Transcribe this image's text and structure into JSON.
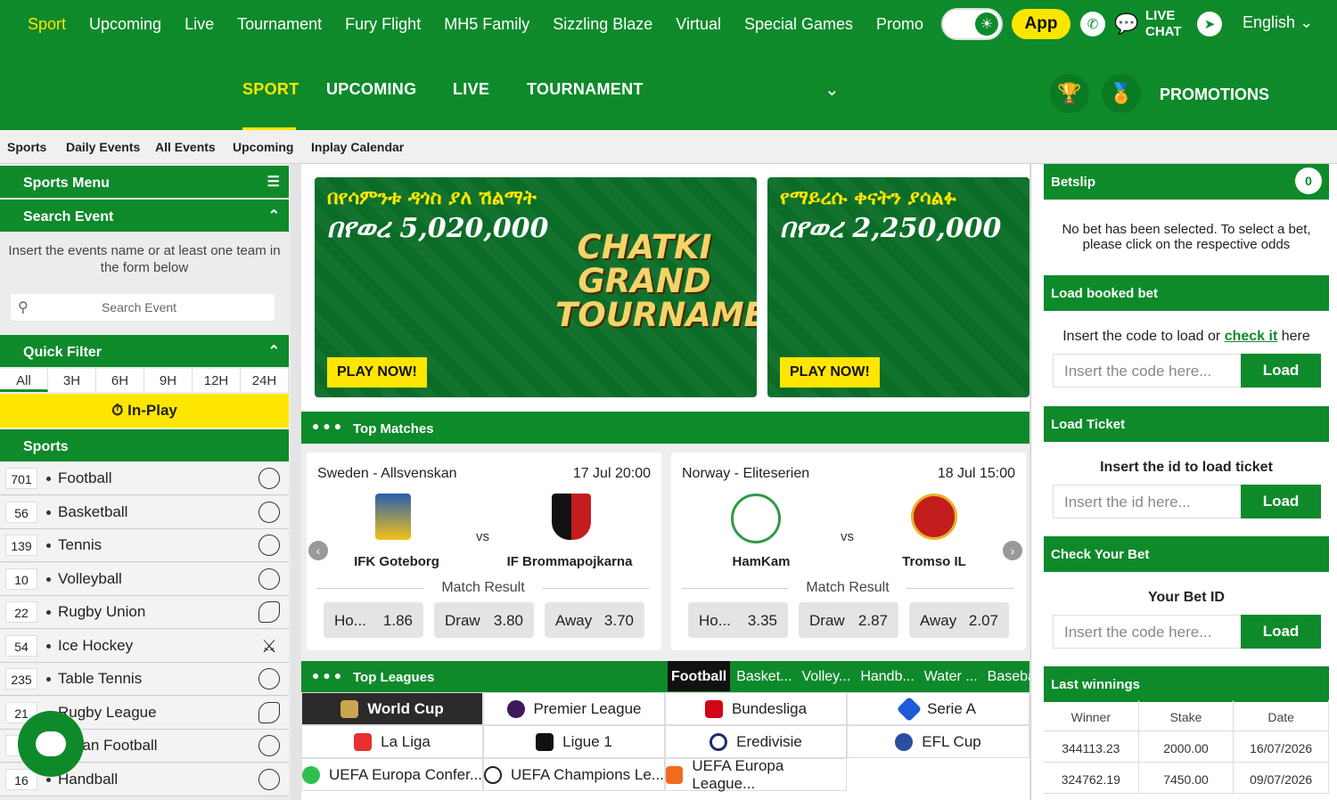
{
  "topnav": [
    "Sport",
    "Upcoming",
    "Live",
    "Tournament",
    "Fury Flight",
    "MH5 Family",
    "Sizzling Blaze",
    "Virtual",
    "Special Games",
    "Promo"
  ],
  "app_label": "App",
  "live_chat": [
    "LIVE",
    "CHAT"
  ],
  "language": "English",
  "secnav": [
    "SPORT",
    "UPCOMING",
    "LIVE",
    "TOURNAMENT"
  ],
  "promotions": "PROMOTIONS",
  "subnav": [
    "Sports",
    "Daily Events",
    "All Events",
    "Upcoming",
    "Inplay Calendar"
  ],
  "left": {
    "sports_menu": "Sports Menu",
    "search_event": "Search Event",
    "hint": "Insert the events name or at least one team in the form below",
    "search_placeholder": "Search Event",
    "quick_filter": "Quick Filter",
    "filters": [
      "All",
      "3H",
      "6H",
      "9H",
      "12H",
      "24H"
    ],
    "inplay": "In-Play",
    "sports_title": "Sports",
    "sports": [
      {
        "count": "701",
        "name": "Football"
      },
      {
        "count": "56",
        "name": "Basketball"
      },
      {
        "count": "139",
        "name": "Tennis"
      },
      {
        "count": "10",
        "name": "Volleyball"
      },
      {
        "count": "22",
        "name": "Rugby Union"
      },
      {
        "count": "54",
        "name": "Ice Hockey"
      },
      {
        "count": "235",
        "name": "Table Tennis"
      },
      {
        "count": "21",
        "name": "Rugby League"
      },
      {
        "count": "",
        "name": "erican Football"
      },
      {
        "count": "16",
        "name": "Handball"
      }
    ]
  },
  "banners": [
    {
      "line1": "በየሳምንቱ ዳጎስ ያለ ሽልማት",
      "line2": "በየወረ 5,020,000",
      "logo": "CHATKI GRAND TOURNAMENT",
      "cta": "PLAY NOW!"
    },
    {
      "line1": "የማይረሱ ቀናትን ያሳልፉ",
      "line2": "በየወረ 2,250,000",
      "cta": "PLAY NOW!"
    }
  ],
  "top_matches": {
    "title": "Top Matches",
    "matches": [
      {
        "league": "Sweden - Allsvenskan",
        "date": "17 Jul 20:00",
        "home": "IFK Goteborg",
        "away": "IF Brommapojkarna",
        "vs": "vs",
        "market": "Match Result",
        "odds": [
          {
            "label": "Ho...",
            "value": "1.86"
          },
          {
            "label": "Draw",
            "value": "3.80"
          },
          {
            "label": "Away",
            "value": "3.70"
          }
        ]
      },
      {
        "league": "Norway - Eliteserien",
        "date": "18 Jul 15:00",
        "home": "HamKam",
        "away": "Tromso IL",
        "vs": "vs",
        "market": "Match Result",
        "odds": [
          {
            "label": "Ho...",
            "value": "3.35"
          },
          {
            "label": "Draw",
            "value": "2.87"
          },
          {
            "label": "Away",
            "value": "2.07"
          }
        ]
      }
    ]
  },
  "top_leagues": {
    "title": "Top Leagues",
    "tabs": [
      "Football",
      "Basket...",
      "Volley...",
      "Handb...",
      "Water ...",
      "Baseball"
    ],
    "leagues": [
      "World Cup",
      "Premier League",
      "Bundesliga",
      "Serie A",
      "La Liga",
      "Ligue 1",
      "Eredivisie",
      "EFL Cup",
      "UEFA Europa Confer...",
      "UEFA Champions Le...",
      "UEFA Europa League..."
    ]
  },
  "right": {
    "betslip": "Betslip",
    "betslip_count": "0",
    "no_bet": "No bet has been selected. To select a bet, please click on the respective odds",
    "load_booked": "Load booked bet",
    "insert_code_pre": "Insert the code to load or ",
    "check_it": "check it",
    "insert_code_post": " here",
    "code_placeholder": "Insert the code here...",
    "load": "Load",
    "load_ticket": "Load Ticket",
    "insert_id_text": "Insert the id to load ticket",
    "id_placeholder": "Insert the id here...",
    "check_bet": "Check Your Bet",
    "your_bet_id": "Your Bet ID",
    "last_winnings": "Last winnings",
    "winnings_headers": [
      "Winner",
      "Stake",
      "Date"
    ],
    "winnings": [
      [
        "344113.23",
        "2000.00",
        "16/07/2026"
      ],
      [
        "324762.19",
        "7450.00",
        "09/07/2026"
      ]
    ]
  }
}
